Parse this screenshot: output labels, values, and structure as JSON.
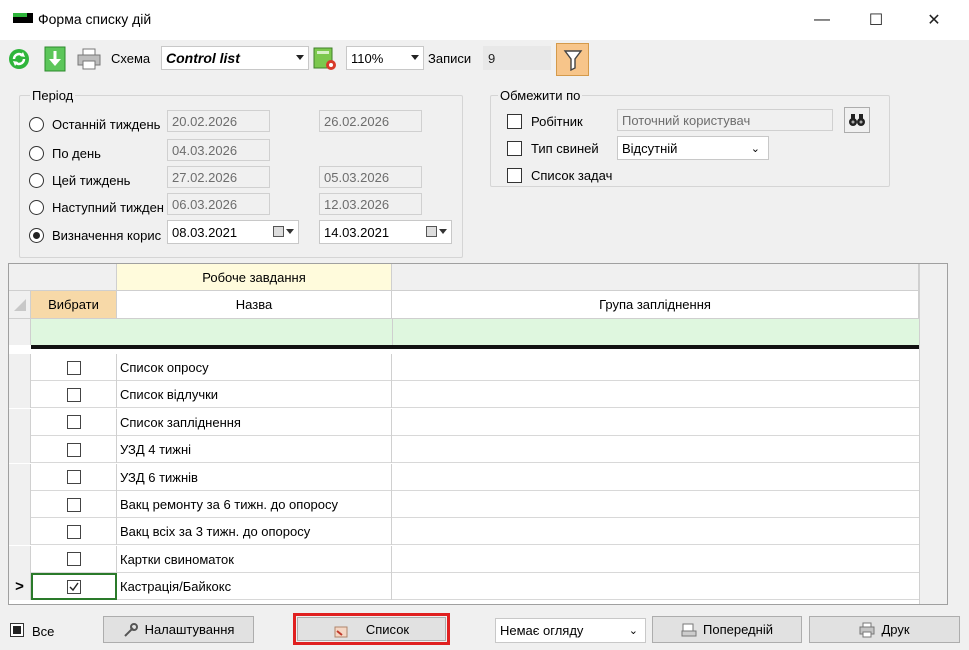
{
  "window": {
    "title": "Форма списку дій",
    "minimize_glyph": "—",
    "maximize_glyph": "☐",
    "close_glyph": "✕"
  },
  "toolbar": {
    "schema_label": "Схема",
    "schema_value": "Control list",
    "zoom_value": "110%",
    "records_label": "Записи",
    "records_value": "9"
  },
  "period": {
    "title": "Період",
    "options": [
      {
        "label": "Останній тиждень",
        "from": "20.02.2026",
        "to": "26.02.2026",
        "selected": false
      },
      {
        "label": "По день",
        "from": "04.03.2026",
        "to": "",
        "selected": false
      },
      {
        "label": "Цей тиждень",
        "from": "27.02.2026",
        "to": "05.03.2026",
        "selected": false
      },
      {
        "label": "Наступний тижден",
        "from": "06.03.2026",
        "to": "12.03.2026",
        "selected": false
      },
      {
        "label": "Визначення корис",
        "from": "08.03.2021",
        "to": "14.03.2021",
        "selected": true
      }
    ]
  },
  "limit": {
    "title": "Обмежити по",
    "worker_label": "Робітник",
    "worker_value": "Поточний користувач",
    "pig_type_label": "Тип свиней",
    "pig_type_value": "Відсутній",
    "task_list_label": "Список задач"
  },
  "grid": {
    "band_header": "Робоче завдання",
    "col_select": "Вибрати",
    "col_name": "Назва",
    "col_group": "Група запліднення",
    "rows": [
      {
        "name": "Список опросу",
        "checked": false,
        "current": false
      },
      {
        "name": "Список відлучки",
        "checked": false,
        "current": false
      },
      {
        "name": "Список запліднення",
        "checked": false,
        "current": false
      },
      {
        "name": "УЗД 4 тижні",
        "checked": false,
        "current": false
      },
      {
        "name": "УЗД 6 тижнів",
        "checked": false,
        "current": false
      },
      {
        "name": "Вакц ремонту за 6 тижн. до опоросу",
        "checked": false,
        "current": false
      },
      {
        "name": "Вакц всіх за 3 тижн. до опоросу",
        "checked": false,
        "current": false
      },
      {
        "name": "Картки свиноматок",
        "checked": false,
        "current": false
      },
      {
        "name": "Кастрація/Байкокс",
        "checked": true,
        "current": true
      }
    ],
    "current_marker": ">"
  },
  "footer": {
    "all_label": "Все",
    "settings_button": "Налаштування",
    "list_button": "Список",
    "preview_value": "Немає огляду",
    "previous_button": "Попередній",
    "print_button": "Друк"
  },
  "colors": {
    "select_header_bg": "#f7d9a8",
    "band_header_bg": "#fffbdc",
    "filter_row_bg": "#dff7df",
    "highlight_border": "#e02020",
    "accent_green": "#2fb53b"
  }
}
